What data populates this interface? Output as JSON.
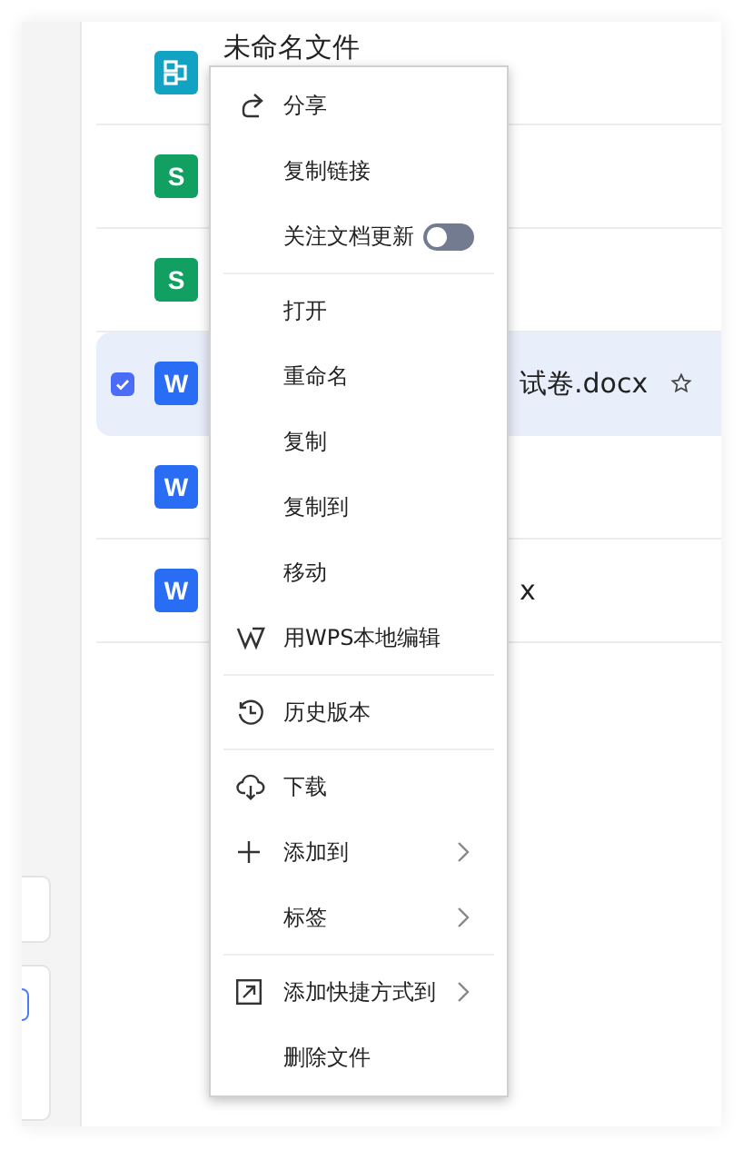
{
  "files": [
    {
      "kind": "flow",
      "name": "未命名文件",
      "selected": false
    },
    {
      "kind": "sheet",
      "letter": "S",
      "selected": false
    },
    {
      "kind": "sheet",
      "letter": "S",
      "selected": false
    },
    {
      "kind": "doc",
      "letter": "W",
      "name": "试卷.docx",
      "selected": true
    },
    {
      "kind": "doc",
      "letter": "W",
      "selected": false
    },
    {
      "kind": "doc",
      "letter": "W",
      "name": "x",
      "selected": false
    }
  ],
  "menu": {
    "sections": [
      [
        {
          "label": "分享"
        },
        {
          "label": "复制链接"
        },
        {
          "kind": "toggle",
          "label": "关注文档更新",
          "on": false
        }
      ],
      [
        {
          "label": "打开"
        },
        {
          "label": "重命名"
        },
        {
          "label": "复制"
        },
        {
          "label": "复制到"
        },
        {
          "label": "移动"
        },
        {
          "label": "用WPS本地编辑"
        }
      ],
      [
        {
          "label": "历史版本"
        }
      ],
      [
        {
          "label": "下载"
        },
        {
          "label": "添加到",
          "submenu": true
        },
        {
          "label": "标签",
          "submenu": true
        }
      ],
      [
        {
          "label": "添加快捷方式到",
          "submenu": true
        },
        {
          "label": "删除文件"
        }
      ]
    ]
  }
}
